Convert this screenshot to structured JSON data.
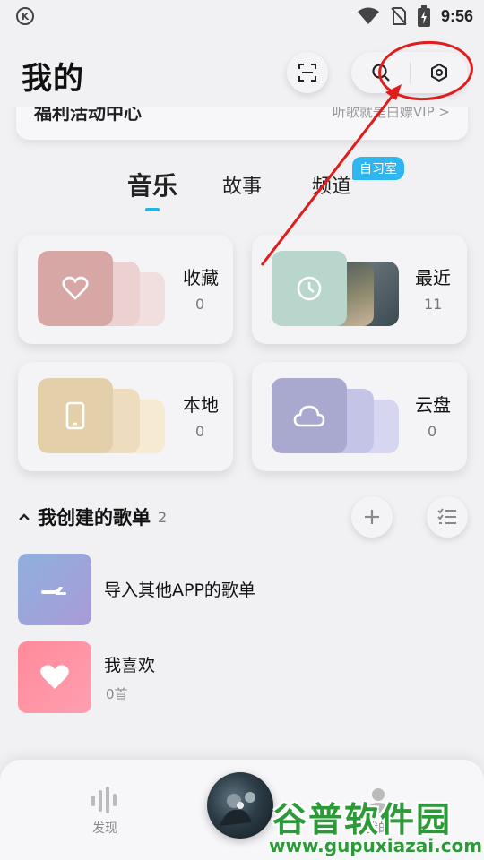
{
  "status_bar": {
    "app_badge": "K",
    "time": "9:56"
  },
  "header": {
    "title": "我的"
  },
  "banner": {
    "left_text": "福利活动中心",
    "right_text": "听歌就是白嫖VIP >"
  },
  "tabs": [
    {
      "label": "音乐",
      "active": true
    },
    {
      "label": "故事",
      "active": false
    },
    {
      "label": "频道",
      "active": false
    }
  ],
  "badge": "自习室",
  "cards": [
    {
      "label": "收藏",
      "count": "0",
      "icon": "heart-icon",
      "color": "#d6a7a5"
    },
    {
      "label": "最近",
      "count": "11",
      "icon": "clock-icon",
      "color": "#b9d6cc"
    },
    {
      "label": "本地",
      "count": "0",
      "icon": "phone-icon",
      "color": "#e3cfa9"
    },
    {
      "label": "云盘",
      "count": "0",
      "icon": "cloud-icon",
      "color": "#a9a9cf"
    }
  ],
  "playlists_section": {
    "title": "我创建的歌单",
    "count": "2"
  },
  "playlists": [
    {
      "name": "导入其他APP的歌单",
      "sub": "",
      "icon": "import-icon"
    },
    {
      "name": "我喜欢",
      "sub": "0首",
      "icon": "heart-icon"
    }
  ],
  "bottom_nav": [
    {
      "label": "发现",
      "icon": "bars-icon"
    },
    {
      "label": "我的",
      "icon": "person-icon"
    }
  ],
  "watermark": {
    "title": "谷普软件园",
    "url": "www.gupuxiazai.com"
  },
  "colors": {
    "accent": "#1fb6e6",
    "annotation": "#e21b1b",
    "watermark": "#2d9a3a"
  }
}
